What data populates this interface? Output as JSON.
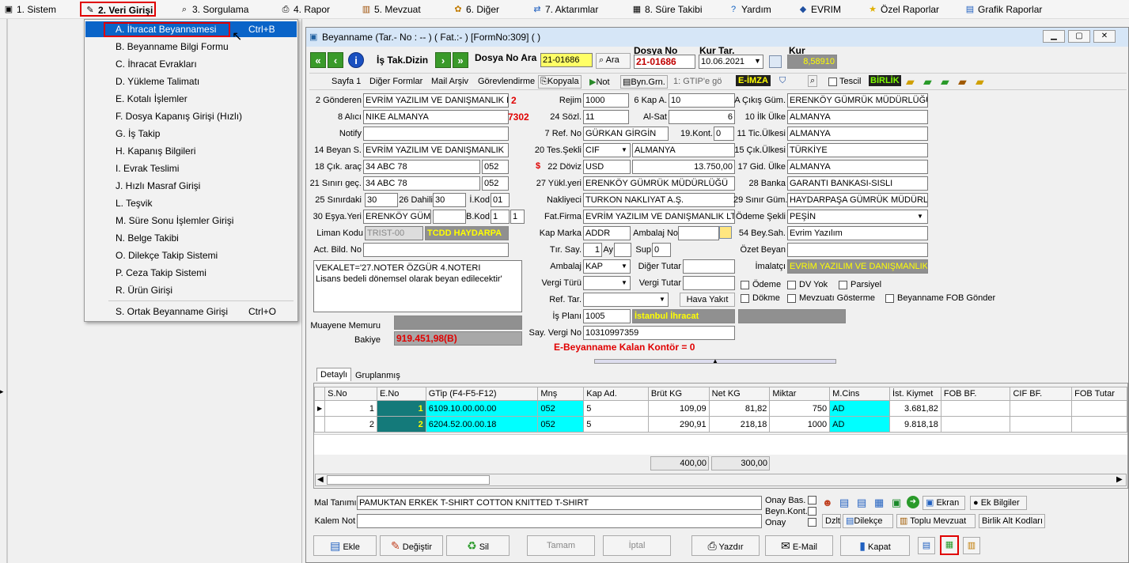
{
  "menubar": {
    "items": [
      {
        "label": "1.  Sistem",
        "icon": "system-icon"
      },
      {
        "label": "2.  Veri Girişi",
        "icon": "edit-icon"
      },
      {
        "label": "3.  Sorgulama",
        "icon": "query-icon"
      },
      {
        "label": "4.  Rapor",
        "icon": "printer-icon"
      },
      {
        "label": "5.  Mevzuat",
        "icon": "books-icon"
      },
      {
        "label": "6.  Diğer",
        "icon": "tools-icon"
      },
      {
        "label": "7.  Aktarımlar",
        "icon": "transfer-icon"
      },
      {
        "label": "8. Süre Takibi",
        "icon": "calendar-icon"
      },
      {
        "label": "Yardım",
        "icon": "help-icon"
      },
      {
        "label": "EVRIM",
        "icon": "evrim-icon"
      },
      {
        "label": "Özel Raporlar",
        "icon": "star-icon"
      },
      {
        "label": "Grafik Raporlar",
        "icon": "chart-icon"
      }
    ]
  },
  "dropdown": {
    "items": [
      {
        "label": "A.  İhracat Beyannamesi",
        "shortcut": "Ctrl+B"
      },
      {
        "label": "B.  Beyanname Bilgi Formu",
        "shortcut": ""
      },
      {
        "label": "C.  İhracat Evrakları",
        "shortcut": ""
      },
      {
        "label": "D.  Yükleme Talimatı",
        "shortcut": ""
      },
      {
        "label": "E.  Kotalı İşlemler",
        "shortcut": ""
      },
      {
        "label": "F.  Dosya Kapanış Girişi (Hızlı)",
        "shortcut": ""
      },
      {
        "label": "G.  İş Takip",
        "shortcut": ""
      },
      {
        "label": "H.  Kapanış Bilgileri",
        "shortcut": ""
      },
      {
        "label": "I.  Evrak Teslimi",
        "shortcut": ""
      },
      {
        "label": "J.  Hızlı Masraf Girişi",
        "shortcut": ""
      },
      {
        "label": "L.  Teşvik",
        "shortcut": ""
      },
      {
        "label": "M.  Süre Sonu İşlemler Girişi",
        "shortcut": ""
      },
      {
        "label": "N.  Belge Takibi",
        "shortcut": ""
      },
      {
        "label": "O.  Dilekçe Takip Sistemi",
        "shortcut": ""
      },
      {
        "label": "P.  Ceza Takip Sistemi",
        "shortcut": ""
      },
      {
        "label": "R.  Ürün Girişi",
        "shortcut": ""
      },
      {
        "label": "S.  Ortak Beyanname Girişi",
        "shortcut": "Ctrl+O"
      }
    ]
  },
  "window": {
    "title": "Beyanname (Tar.- No : -- ) ( Fat.:- ) [FormNo:309] ( )",
    "is_tak_dizin": "İş Tak.Dizin",
    "dosya_no_ara_label": "Dosya No Ara",
    "dosya_no_ara_value": "21-01686",
    "ara_button": "Ara",
    "dosya_no_label": "Dosya No",
    "dosya_no_value": "21-01686",
    "kur_tar_label": "Kur Tar.",
    "kur_tar_value": "10.06.2021",
    "kur_label": "Kur",
    "kur_value": "8,58910"
  },
  "toolbar2": {
    "sayfa1": "Sayfa 1",
    "diger_formlar": "Diğer Formlar",
    "mail_arsiv": "Mail Arşiv",
    "gorevlendirme": "Görevlendirme",
    "kopyala": "Kopyala",
    "not": "Not",
    "byn_grn": "Byn.Grn.",
    "gtip_select": "1: GTIP'e gö",
    "e_imza": "E-İMZA",
    "tescil": "Tescil",
    "birlik": "BİRLİK"
  },
  "form": {
    "gonderen_label": "2 Gönderen",
    "gonderen": "EVRİM YAZILIM VE DANIŞMANLIK L",
    "gonderen_code": "2",
    "alici_label": "8 Alıcı",
    "alici": "NIKE ALMANYA",
    "alici_code": "7302",
    "notify_label": "Notify",
    "notify": "",
    "beyan_label": "14 Beyan S.",
    "beyan": "EVRİM YAZILIM VE DANIŞMANLIK",
    "cik_arac_label": "18 Çık. araç",
    "cik_arac": "34 ABC 78",
    "cik_arac_code": "052",
    "sinir_gec_label": "21 Sınırı geç.",
    "sinir_gec": "34 ABC 78",
    "sinir_gec_code": "052",
    "sinirdaki_label": "25 Sınırdaki",
    "sinirdaki": "30",
    "dahili_label": "26 Dahili",
    "dahili": "30",
    "ikod_label": "İ.Kod",
    "ikod": "01",
    "esya_yeri_label": "30 Eşya.Yeri",
    "esya_yeri": "ERENKÖY GÜM",
    "bkod_label": "B.Kod",
    "bkod1": "1",
    "bkod2": "1",
    "liman_label": "Liman Kodu",
    "liman": "TRIST-00",
    "liman_name": "TCDD HAYDARPA",
    "act_bild_label": "Act. Bild. No",
    "act_bild": "",
    "notes": "VEKALET='27.NOTER ÖZGÜR 4.NOTERI Lisans bedeli dönemsel olarak beyan edilecektir'",
    "muayene_label": "Muayene Memuru",
    "muayene": "",
    "bakiye_label": "Bakiye",
    "bakiye": "919.451,98(B)",
    "rejim_label": "Rejim",
    "rejim": "1000",
    "kap_a_label": "6 Kap A.",
    "kap_a": "10",
    "sozl_label": "24 Sözl.",
    "sozl": "11",
    "al_sat_label": "Al-Sat",
    "al_sat": "6",
    "ref_no_label": "7 Ref. No",
    "ref_no": "GÜRKAN GİRGİN",
    "kont_label": "19.Kont.",
    "kont": "0",
    "tes_sekli_label": "20 Tes.Şekli",
    "tes_sekli": "CIF",
    "tes_yer": "ALMANYA",
    "doviz_label": "22 Döviz",
    "doviz": "USD",
    "doviz_amount": "13.750,00",
    "yukl_label": "27 Yükl.yeri",
    "yukl": "ERENKÖY GÜMRÜK MÜDÜRLÜĞÜ",
    "nakliyeci_label": "Nakliyeci",
    "nakliyeci": "TURKON NAKLIYAT A.Ş.",
    "fat_firma_label": "Fat.Firma",
    "fat_firma": "EVRİM YAZILIM VE DANIŞMANLIK LT",
    "kap_marka_label": "Kap Marka",
    "kap_marka": "ADDR",
    "ambalaj_no_label": "Ambalaj No",
    "ambalaj_no": "",
    "tir_label": "Tır. Say.",
    "tir": "1",
    "ay_label": "Ay",
    "ay": "",
    "sup_label": "Sup",
    "sup": "0",
    "ambalaj_label": "Ambalaj",
    "ambalaj": "KAP",
    "diger_tutar_label": "Diğer Tutar",
    "diger_tutar": "",
    "vergi_turu_label": "Vergi Türü",
    "vergi_turu": "",
    "vergi_tutar_label": "Vergi Tutar",
    "vergi_tutar": "",
    "ref_tar_label": "Ref. Tar.",
    "ref_tar": "",
    "hava_yakit": "Hava Yakıt",
    "is_plani_label": "İş Planı",
    "is_plani": "1005",
    "is_plani_name": "İstanbul İhracat",
    "say_vergi_label": "Say. Vergi No",
    "say_vergi": "10310997359",
    "kontor": "E-Beyanname Kalan Kontör = 0",
    "cikis_gum_label": "A Çıkış Güm.",
    "cikis_gum": "ERENKÖY GÜMRÜK MÜDÜRLÜĞÜ",
    "ilk_ulke_label": "10 İlk Ülke",
    "ilk_ulke": "ALMANYA",
    "tic_ulkesi_label": "11 Tic.Ülkesi",
    "tic_ulkesi": "ALMANYA",
    "cik_ulkesi_label": "15 Çık.Ülkesi",
    "cik_ulkesi": "TÜRKİYE",
    "gid_ulke_label": "17 Gid. Ülke",
    "gid_ulke": "ALMANYA",
    "banka_label": "28 Banka",
    "banka": "GARANTI BANKASI-SISLI",
    "sinir_gum_label": "29 Sınır Güm.",
    "sinir_gum": "HAYDARPAŞA GÜMRÜK MÜDÜRL",
    "odeme_sekli_label": "Ödeme Şekli",
    "odeme_sekli": "PEŞİN",
    "bey_sah_label": "54 Bey.Sah.",
    "bey_sah": "Evrim Yazılım",
    "ozet_beyan_label": "Özet Beyan",
    "ozet_beyan": "",
    "imalatci_label": "İmalatçı",
    "imalatci": "EVRİM YAZILIM VE DANIŞMANLIK",
    "odeme_chk": "Ödeme",
    "dv_yok_chk": "DV Yok",
    "parsiyel_chk": "Parsiyel",
    "dokme_chk": "Dökme",
    "mevzuati_chk": "Mevzuatı Gösterme",
    "fob_chk": "Beyanname FOB Gönder"
  },
  "tabs": {
    "detayli": "Detaylı",
    "gruplanmis": "Gruplanmış"
  },
  "grid": {
    "headers": [
      "S.No",
      "E.No",
      "GTip (F4-F5-F12)",
      "Mnş",
      "Kap Ad.",
      "Brüt KG",
      "Net KG",
      "Miktar",
      "M.Cins",
      "İst. Kiymet",
      "FOB BF.",
      "CIF BF.",
      "FOB Tutar"
    ],
    "rows": [
      [
        "1",
        "1",
        "6109.10.00.00.00",
        "052",
        "5",
        "109,09",
        "81,82",
        "750",
        "AD",
        "3.681,82",
        "",
        "",
        ""
      ],
      [
        "2",
        "2",
        "6204.52.00.00.18",
        "052",
        "5",
        "290,91",
        "218,18",
        "1000",
        "AD",
        "9.818,18",
        "",
        "",
        ""
      ]
    ],
    "total_brut": "400,00",
    "total_net": "300,00"
  },
  "bottom": {
    "mal_tanimi_label": "Mal Tanımı",
    "mal_tanimi": "PAMUKTAN ERKEK T-SHIRT COTTON KNITTED T-SHIRT",
    "kalem_not_label": "Kalem Not",
    "kalem_not": "",
    "onay_bas": "Onay Bas.",
    "beyn_kont": "Beyn.Kont.",
    "onay": "Onay",
    "ekran": "Ekran",
    "ek_bilgiler": "Ek Bilgiler",
    "dzlt": "Dzlt",
    "dilekce": "Dilekçe",
    "toplu_mevzuat": "Toplu Mevzuat",
    "birlik_alt": "Birlik Alt Kodları",
    "ekle": "Ekle",
    "degistir": "Değiştir",
    "sil": "Sil",
    "tamam": "Tamam",
    "iptal": "İptal",
    "yazdir": "Yazdır",
    "email": "E-Mail",
    "kapat": "Kapat"
  }
}
